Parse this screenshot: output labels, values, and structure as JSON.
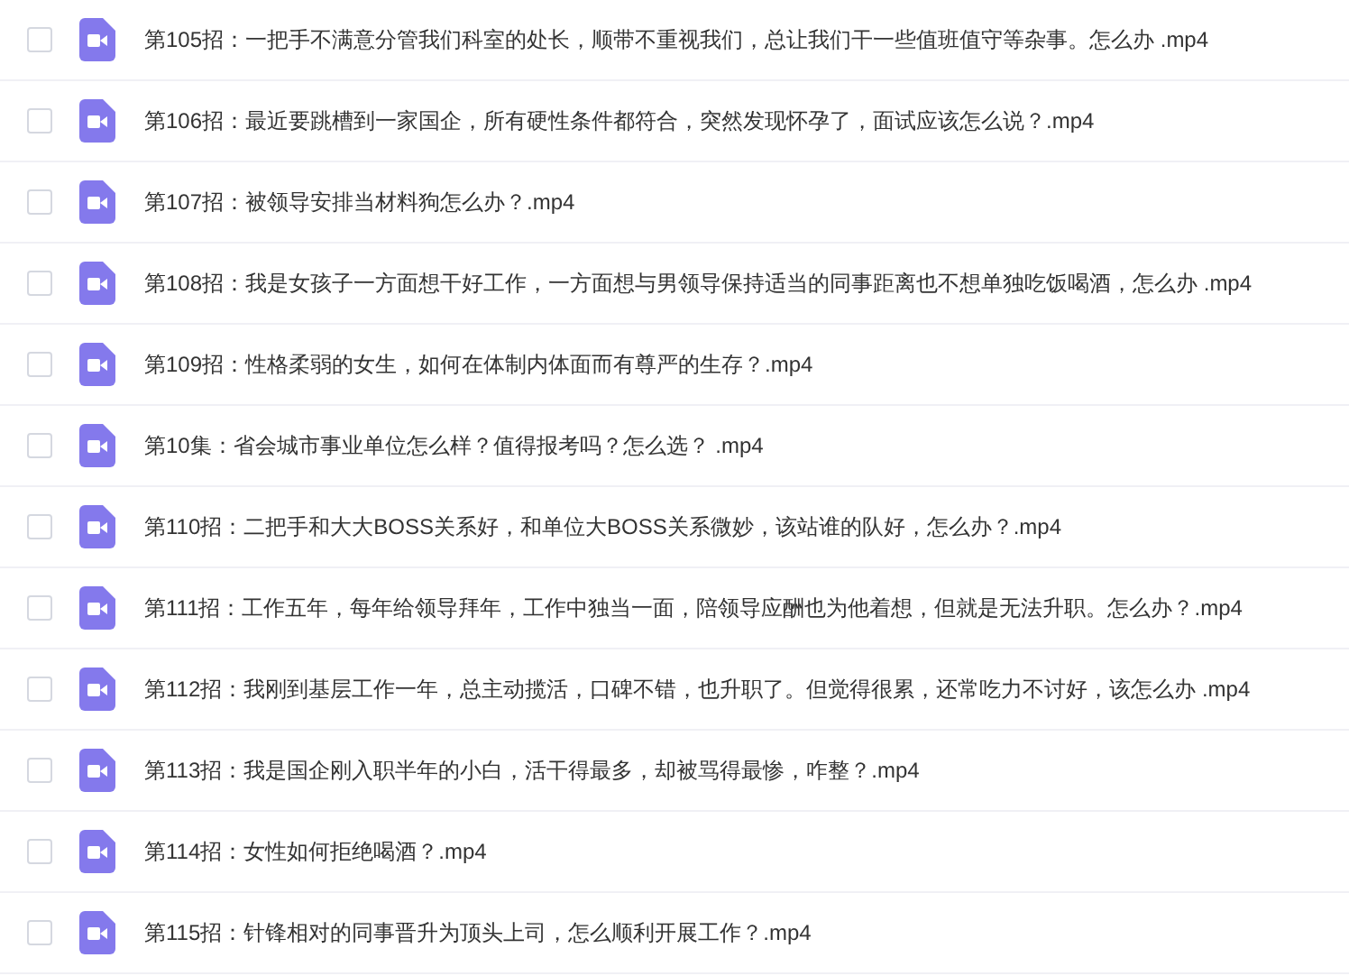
{
  "files": [
    {
      "name": "第105招：一把手不满意分管我们科室的处长，顺带不重视我们，总让我们干一些值班值守等杂事。怎么办 .mp4",
      "checked": false
    },
    {
      "name": "第106招：最近要跳槽到一家国企，所有硬性条件都符合，突然发现怀孕了，面试应该怎么说？.mp4",
      "checked": false
    },
    {
      "name": "第107招：被领导安排当材料狗怎么办？.mp4",
      "checked": false
    },
    {
      "name": "第108招：我是女孩子一方面想干好工作，一方面想与男领导保持适当的同事距离也不想单独吃饭喝酒，怎么办 .mp4",
      "checked": false
    },
    {
      "name": "第109招：性格柔弱的女生，如何在体制内体面而有尊严的生存？.mp4",
      "checked": false
    },
    {
      "name": "第10集：省会城市事业单位怎么样？值得报考吗？怎么选？ .mp4",
      "checked": false
    },
    {
      "name": "第110招：二把手和大大BOSS关系好，和单位大BOSS关系微妙，该站谁的队好，怎么办？.mp4",
      "checked": false
    },
    {
      "name": "第111招：工作五年，每年给领导拜年，工作中独当一面，陪领导应酬也为他着想，但就是无法升职。怎么办？.mp4",
      "checked": false
    },
    {
      "name": "第112招：我刚到基层工作一年，总主动揽活，口碑不错，也升职了。但觉得很累，还常吃力不讨好，该怎么办 .mp4",
      "checked": false
    },
    {
      "name": "第113招：我是国企刚入职半年的小白，活干得最多，却被骂得最惨，咋整？.mp4",
      "checked": false
    },
    {
      "name": "第114招：女性如何拒绝喝酒？.mp4",
      "checked": false
    },
    {
      "name": "第115招：针锋相对的同事晋升为顶头上司，怎么顺利开展工作？.mp4",
      "checked": false
    }
  ]
}
